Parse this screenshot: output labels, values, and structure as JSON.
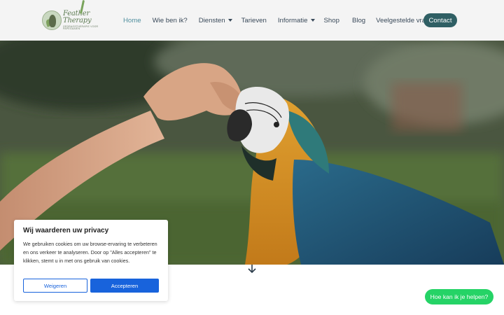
{
  "brand": {
    "name": "Feather Therapy",
    "tagline": "GEDRAGSTHERAPIE VOOR PAPEGAAIEN"
  },
  "nav": {
    "items": [
      {
        "label": "Home",
        "active": true,
        "dropdown": false
      },
      {
        "label": "Wie ben ik?",
        "active": false,
        "dropdown": false
      },
      {
        "label": "Diensten",
        "active": false,
        "dropdown": true
      },
      {
        "label": "Tarieven",
        "active": false,
        "dropdown": false
      },
      {
        "label": "Informatie",
        "active": false,
        "dropdown": true
      },
      {
        "label": "Shop",
        "active": false,
        "dropdown": false
      },
      {
        "label": "Blog",
        "active": false,
        "dropdown": false
      },
      {
        "label": "Veelgestelde vragen",
        "active": false,
        "dropdown": false
      }
    ],
    "contact_label": "Contact"
  },
  "hero": {
    "image_icon": "parrot-photo",
    "scroll_icon": "arrow-down-icon"
  },
  "cookie": {
    "title": "Wij waarderen uw privacy",
    "body": "We gebruiken cookies om uw browse-ervaring te verbeteren en ons verkeer te analyseren. Door op \"Alles accepteren\" te klikken, stemt u in met ons gebruik van cookies.",
    "reject_label": "Weigeren",
    "accept_label": "Accepteren"
  },
  "chat": {
    "label": "Hoe kan ik je helpen?"
  },
  "colors": {
    "header_bg": "#f4f4f4",
    "nav_active": "#4f8e9e",
    "contact_bg": "#2f5f64",
    "cookie_accent": "#1863dc",
    "chat_bg": "#25d366"
  }
}
